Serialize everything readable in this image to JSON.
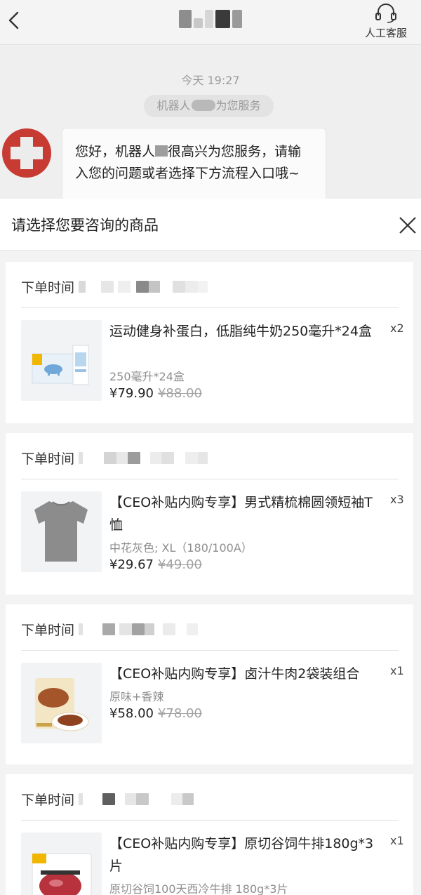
{
  "header": {
    "service_label": "人工客服"
  },
  "chat": {
    "timestamp": "今天 19:27",
    "system_prefix": "机器人",
    "system_suffix": "为您服务",
    "greeting_prefix": "您好，机器人",
    "greeting_suffix": "很高兴为您服务，请输入您的问题或者选择下方流程入口哦~"
  },
  "sheet": {
    "title": "请选择您要咨询的商品"
  },
  "orders": [
    {
      "time_label": "下单时间",
      "product": {
        "name": "运动健身补蛋白，低脂纯牛奶250毫升*24盒",
        "spec": "250毫升*24盒",
        "price": "¥79.90",
        "original_price": "¥88.00",
        "qty": "x2",
        "image_icon": "milk-box-image"
      }
    },
    {
      "time_label": "下单时间",
      "product": {
        "name": "【CEO补贴内购专享】男式精梳棉圆领短袖T恤",
        "spec": "中花灰色; XL（180/100A）",
        "price": "¥29.67",
        "original_price": "¥49.00",
        "qty": "x3",
        "image_icon": "gray-tshirt-image"
      }
    },
    {
      "time_label": "下单时间",
      "product": {
        "name": "【CEO补贴内购专享】卤汁牛肉2袋装组合",
        "spec": "原味+香辣",
        "price": "¥58.00",
        "original_price": "¥78.00",
        "qty": "x1",
        "image_icon": "braised-beef-image"
      }
    },
    {
      "time_label": "下单时间",
      "product": {
        "name": "【CEO补贴内购专享】原切谷饲牛排180g*3片",
        "spec": "原切谷饲100天西冷牛排 180g*3片",
        "price": "",
        "original_price": "",
        "qty": "x1",
        "image_icon": "steak-pack-image"
      }
    }
  ],
  "colors": {
    "accent_red": "#c73b33",
    "text_dark": "#222222",
    "text_gray": "#8e8e8e",
    "sheet_bg": "#f3f3f3"
  }
}
